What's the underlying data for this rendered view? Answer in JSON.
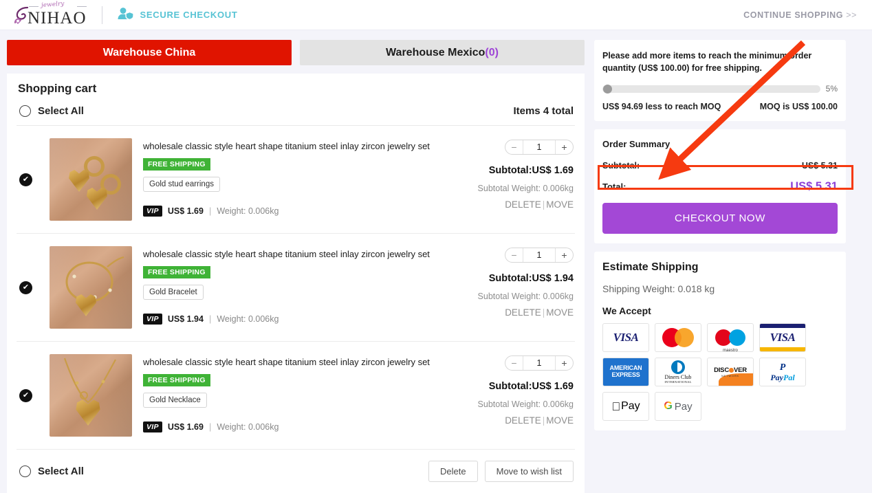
{
  "header": {
    "logo_text": "NIHAO",
    "logo_script": "jewelry",
    "secure_label": "SECURE CHECKOUT",
    "continue_shopping": "CONTINUE SHOPPING",
    "continue_chevron": ">>"
  },
  "tabs": [
    {
      "label": "Warehouse China",
      "count": "",
      "active": true
    },
    {
      "label": "Warehouse Mexico",
      "count": "(0)",
      "active": false
    }
  ],
  "cart": {
    "title": "Shopping cart",
    "select_all_top": "Select All",
    "items_total": "Items 4 total",
    "select_all_bottom": "Select All",
    "delete_button": "Delete",
    "move_button": "Move to wish list",
    "items": [
      {
        "title": "wholesale classic style heart shape titanium steel inlay zircon jewelry set",
        "shipping_badge": "FREE SHIPPING",
        "variant": "Gold stud earrings",
        "vip_badge": "VIP",
        "vip_price": "US$ 1.69",
        "weight": "Weight: 0.006kg",
        "qty": "1",
        "subtotal": "Subtotal:US$ 1.69",
        "subtotal_weight": "Subtotal Weight: 0.006kg",
        "delete": "DELETE",
        "move": "MOVE",
        "selected": true
      },
      {
        "title": "wholesale classic style heart shape titanium steel inlay zircon jewelry set",
        "shipping_badge": "FREE SHIPPING",
        "variant": "Gold Bracelet",
        "vip_badge": "VIP",
        "vip_price": "US$ 1.94",
        "weight": "Weight: 0.006kg",
        "qty": "1",
        "subtotal": "Subtotal:US$ 1.94",
        "subtotal_weight": "Subtotal Weight: 0.006kg",
        "delete": "DELETE",
        "move": "MOVE",
        "selected": true
      },
      {
        "title": "wholesale classic style heart shape titanium steel inlay zircon jewelry set",
        "shipping_badge": "FREE SHIPPING",
        "variant": "Gold Necklace",
        "vip_badge": "VIP",
        "vip_price": "US$ 1.69",
        "weight": "Weight: 0.006kg",
        "qty": "1",
        "subtotal": "Subtotal:US$ 1.69",
        "subtotal_weight": "Subtotal Weight: 0.006kg",
        "delete": "DELETE",
        "move": "MOVE",
        "selected": true
      }
    ]
  },
  "moq": {
    "notice": "Please add more items to reach the minimum order quantity (US$ 100.00) for free shipping.",
    "percent_label": "5%",
    "percent_value": 5,
    "less_to_reach": "US$ 94.69 less to reach MOQ",
    "moq_is": "MOQ is US$ 100.00"
  },
  "order_summary": {
    "title": "Order Summary",
    "subtotal_label": "Subtotal:",
    "subtotal_value": "US$ 5.31",
    "total_label": "Total:",
    "total_value": "US$ 5.31",
    "checkout_button": "CHECKOUT NOW"
  },
  "shipping": {
    "title": "Estimate Shipping",
    "weight": "Shipping Weight: 0.018 kg",
    "accept_title": "We Accept",
    "methods": [
      "visa",
      "mastercard",
      "maestro",
      "visa-electron",
      "american-express",
      "diners-club",
      "discover",
      "paypal",
      "apple-pay",
      "google-pay"
    ],
    "labels": {
      "visa": "VISA",
      "maestro": "maestro",
      "amex_line1": "AMERICAN",
      "amex_line2": "EXPRESS",
      "diners_line1": "Diners Club",
      "diners_line2": "INTERNATIONAL",
      "discover": "DISC",
      "discover_tail": "VER",
      "discover_sub": "NETWORK",
      "paypal_pay": "Pay",
      "paypal_pal": "Pal",
      "apple_pay": "Pay",
      "google_pay": "Pay"
    }
  },
  "colors": {
    "tab_active": "#e01400",
    "accent_purple": "#a348d6",
    "total_purple": "#8b3fd6",
    "free_shipping_green": "#3fb336",
    "annotation_red": "#f63a10",
    "secure_teal": "#57c3d4"
  }
}
